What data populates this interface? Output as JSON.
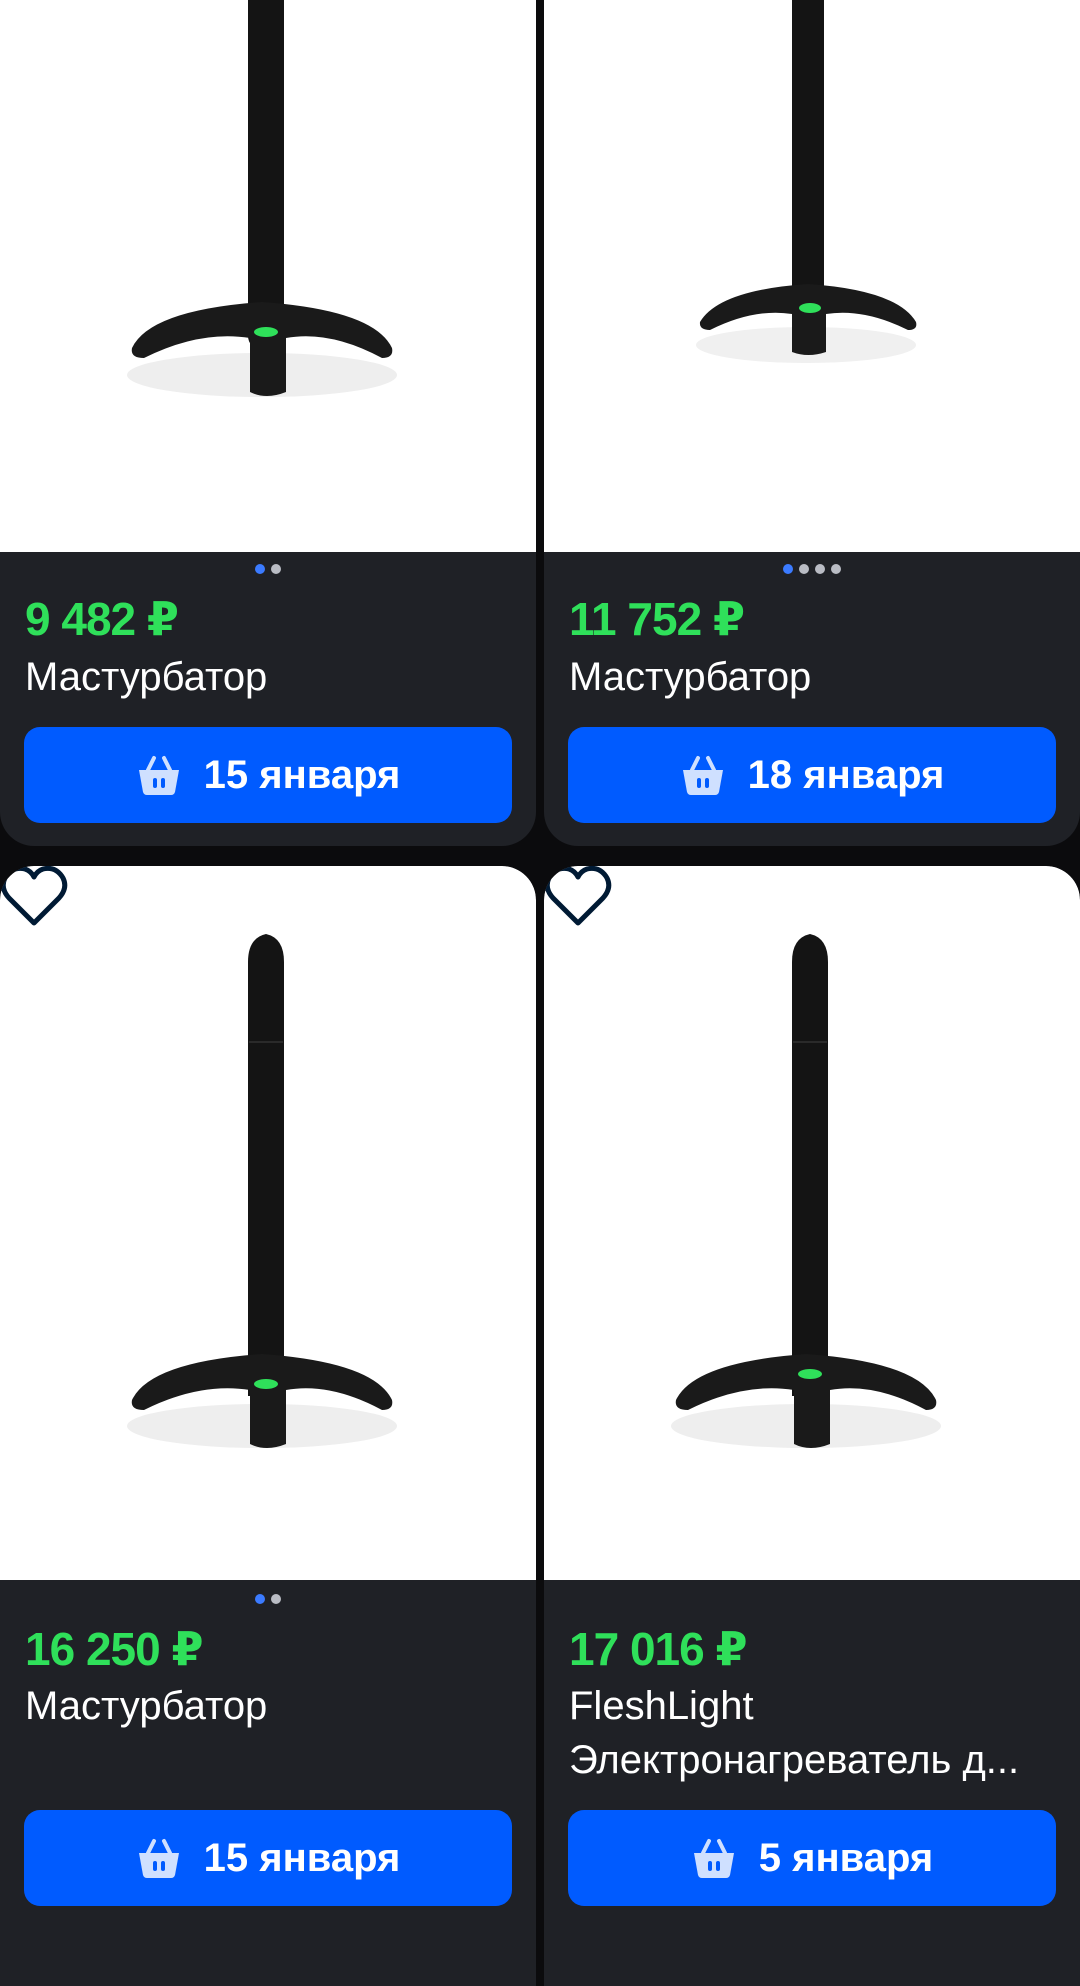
{
  "colors": {
    "price_green": "#2fe05a",
    "accent_blue": "#005bff",
    "card_bg": "#1f2126",
    "page_bg": "#0b0b0d"
  },
  "products": [
    {
      "price": "9 482 ₽",
      "title": "Мастурбатор",
      "delivery_label": "15 января",
      "image_dots": 2,
      "active_dot": 0,
      "favorite_icon": "heart-icon"
    },
    {
      "price": "11 752 ₽",
      "title": "Мастурбатор",
      "delivery_label": "18 января",
      "image_dots": 4,
      "active_dot": 0,
      "favorite_icon": "heart-icon"
    },
    {
      "price": "16 250 ₽",
      "title": "Мастурбатор",
      "delivery_label": "15 января",
      "image_dots": 2,
      "active_dot": 0,
      "favorite_icon": "heart-icon"
    },
    {
      "price": "17 016 ₽",
      "title": "FleshLight",
      "title_line2": "Электронагреватель д...",
      "delivery_label": "5 января",
      "image_dots": 0,
      "active_dot": 0,
      "favorite_icon": "heart-icon"
    }
  ]
}
